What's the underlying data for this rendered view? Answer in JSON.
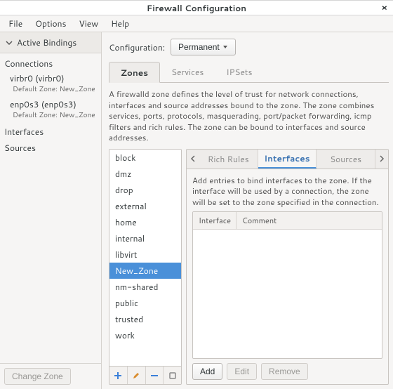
{
  "window": {
    "title": "Firewall Configuration"
  },
  "menu": {
    "file": "File",
    "options": "Options",
    "view": "View",
    "help": "Help"
  },
  "sidebar": {
    "header": "Active Bindings",
    "connections_label": "Connections",
    "interfaces_label": "Interfaces",
    "sources_label": "Sources",
    "conn1": {
      "name": "virbr0 (virbr0)",
      "sub": "Default Zone: New_Zone"
    },
    "conn2": {
      "name": "enp0s3 (enp0s3)",
      "sub": "Default Zone: New_Zone"
    },
    "change_zone": "Change Zone"
  },
  "config": {
    "label": "Configuration:",
    "value": "Permanent"
  },
  "tabs": {
    "zones": "Zones",
    "services": "Services",
    "ipsets": "IPSets"
  },
  "zone_desc": "A firewalld zone defines the level of trust for network connections, interfaces and source addresses bound to the zone. The zone combines services, ports, protocols, masquerading, port/packet forwarding, icmp filters and rich rules. The zone can be bound to interfaces and source addresses.",
  "zones": {
    "z0": "block",
    "z1": "dmz",
    "z2": "drop",
    "z3": "external",
    "z4": "home",
    "z5": "internal",
    "z6": "libvirt",
    "z7": "New_Zone",
    "z8": "nm-shared",
    "z9": "public",
    "z10": "trusted",
    "z11": "work"
  },
  "subtabs": {
    "rich": "Rich Rules",
    "interfaces": "Interfaces",
    "sources": "Sources"
  },
  "iface_desc": "Add entries to bind interfaces to the zone. If the interface will be used by a connection, the zone will be set to the zone specified in the connection.",
  "iface_cols": {
    "c0": "Interface",
    "c1": "Comment"
  },
  "buttons": {
    "add": "Add",
    "edit": "Edit",
    "remove": "Remove"
  }
}
